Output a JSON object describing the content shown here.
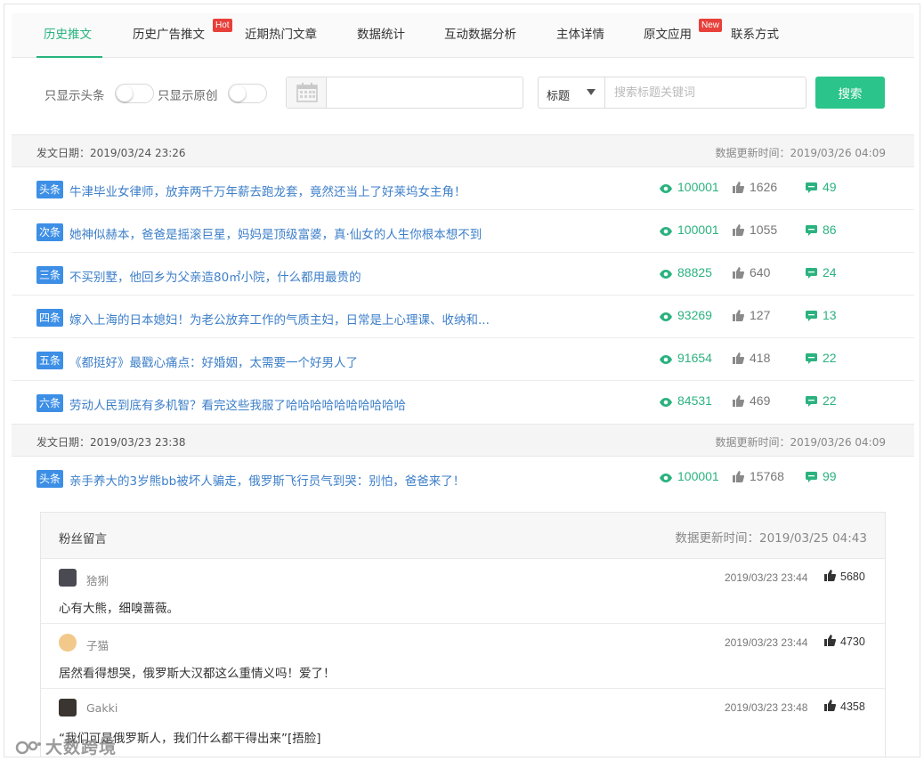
{
  "tabs": [
    {
      "label": "历史推文",
      "active": true
    },
    {
      "label": "历史广告推文",
      "badge": "Hot"
    },
    {
      "label": "近期热门文章"
    },
    {
      "label": "数据统计"
    },
    {
      "label": "互动数据分析"
    },
    {
      "label": "主体详情"
    },
    {
      "label": "原文应用",
      "badge": "New"
    },
    {
      "label": "联系方式"
    }
  ],
  "filters": {
    "headline_only_label": "只显示头条",
    "headline_only_on": false,
    "original_only_label": "只显示原创",
    "original_only_on": false,
    "date_value": "",
    "field_select_value": "标题",
    "search_placeholder": "搜索标题关键词",
    "search_value": "",
    "search_button": "搜索"
  },
  "groups": [
    {
      "publish_label": "发文日期：2019/03/24 23:26",
      "update_label": "数据更新时间：2019/03/26 04:09",
      "articles": [
        {
          "rank": "头条",
          "title": "牛津毕业女律师，放弃两千万年薪去跑龙套，竟然还当上了好莱坞女主角！",
          "reads": "100001",
          "likes": "1626",
          "comments": "49"
        },
        {
          "rank": "次条",
          "title": "她神似赫本，爸爸是摇滚巨星，妈妈是顶级富婆，真·仙女的人生你根本想不到",
          "reads": "100001",
          "likes": "1055",
          "comments": "86"
        },
        {
          "rank": "三条",
          "title": "不买别墅，他回乡为父亲造80㎡小院，什么都用最贵的",
          "reads": "88825",
          "likes": "640",
          "comments": "24"
        },
        {
          "rank": "四条",
          "title": "嫁入上海的日本媳妇！为老公放弃工作的气质主妇，日常是上心理课、收纳和...",
          "reads": "93269",
          "likes": "127",
          "comments": "13"
        },
        {
          "rank": "五条",
          "title": "《都挺好》最戳心痛点：好婚姻，太需要一个好男人了",
          "reads": "91654",
          "likes": "418",
          "comments": "22"
        },
        {
          "rank": "六条",
          "title": "劳动人民到底有多机智？看完这些我服了哈哈哈哈哈哈哈哈哈哈",
          "reads": "84531",
          "likes": "469",
          "comments": "22"
        }
      ]
    },
    {
      "publish_label": "发文日期：2019/03/23 23:38",
      "update_label": "数据更新时间：2019/03/26 04:09",
      "articles": [
        {
          "rank": "头条",
          "title": "亲手养大的3岁熊bb被坏人骗走，俄罗斯飞行员气到哭：别怕，爸爸来了！",
          "reads": "100001",
          "likes": "15768",
          "comments": "99"
        }
      ]
    }
  ],
  "comments_panel": {
    "title": "粉丝留言",
    "update_label": "数据更新时间：2019/03/25 04:43",
    "comments": [
      {
        "user": "猞猁",
        "time": "2019/03/23 23:44",
        "likes": "5680",
        "text": "心有大熊，细嗅蔷薇。",
        "avatar_color": "#4a4a52"
      },
      {
        "user": "子猫",
        "time": "2019/03/23 23:44",
        "likes": "4730",
        "text": "居然看得想哭，俄罗斯大汉都这么重情义吗！爱了！",
        "avatar_color": "#f2c98a"
      },
      {
        "user": "Gakki",
        "time": "2019/03/23 23:48",
        "likes": "4358",
        "text": "“我们可是俄罗斯人，我们什么都干得出来”[捂脸]",
        "avatar_color": "#3a3530"
      }
    ]
  },
  "watermark": "大数跨境",
  "colors": {
    "accent": "#2bc48a",
    "rank_badge": "#3d8fe6",
    "link": "#3d7fc9",
    "hot_badge": "#e8403a"
  },
  "icons": {
    "read": "eye-icon",
    "like": "thumbs-up-icon",
    "comment": "comment-icon",
    "date": "calendar-icon"
  }
}
